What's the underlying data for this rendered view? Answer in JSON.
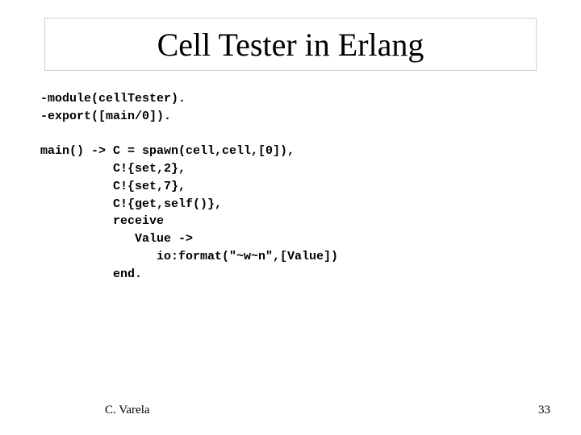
{
  "slide": {
    "title": "Cell Tester in Erlang",
    "code": "-module(cellTester).\n-export([main/0]).\n\nmain() -> C = spawn(cell,cell,[0]),\n          C!{set,2},\n          C!{set,7},\n          C!{get,self()},\n          receive\n             Value ->\n                io:format(\"~w~n\",[Value])\n          end.",
    "footer_author": "C. Varela",
    "footer_page": "33"
  }
}
